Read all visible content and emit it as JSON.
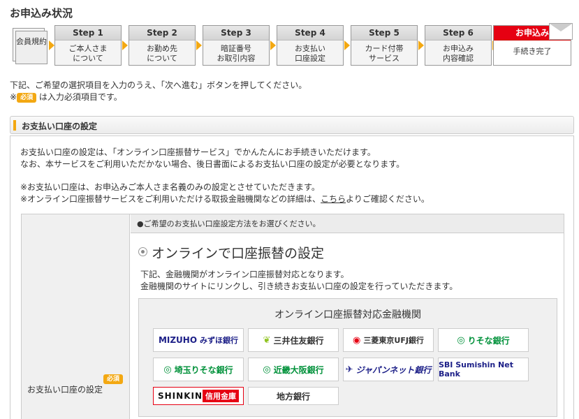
{
  "page": {
    "title": "お申込み状況"
  },
  "steps": {
    "member": "会員規約",
    "items": [
      {
        "head": "Step 1",
        "body1": "ご本人さま",
        "body2": "について"
      },
      {
        "head": "Step 2",
        "body1": "お勤め先",
        "body2": "について"
      },
      {
        "head": "Step 3",
        "body1": "暗証番号",
        "body2": "お取引内容"
      },
      {
        "head": "Step 4",
        "body1": "お支払い",
        "body2": "口座設定"
      },
      {
        "head": "Step 5",
        "body1": "カード付帯",
        "body2": "サービス"
      },
      {
        "head": "Step 6",
        "body1": "お申込み",
        "body2": "内容確認"
      }
    ],
    "final": {
      "head": "お申込み",
      "body": "手続き完了"
    },
    "accent_color": "#e60012",
    "arrow_color": "#f3a812"
  },
  "intro": {
    "line1": "下記、ご希望の選択項目を入力のうえ、「次へ進む」ボタンを押してください。",
    "mark": "※",
    "badge": "必須",
    "line2": "は入力必須項目です。"
  },
  "section": {
    "title": "お支払い口座の設定",
    "desc1": "お支払い口座の設定は、「オンライン口座振替サービス」でかんたんにお手続きいただけます。",
    "desc2": "なお、本サービスをご利用いただかない場合、後日書面によるお支払い口座の設定が必要となります。",
    "note1": "※お支払い口座は、お申込みご本人さま名義のみの設定とさせていただきます。",
    "note2_pre": "※オンライン口座振替サービスをご利用いただける取扱金融機関などの詳細は、",
    "note2_link": "こちら",
    "note2_post": "よりご確認ください。"
  },
  "form": {
    "label": "お支払い口座の設定",
    "required_badge": "必須",
    "select_prompt": "●ご希望のお支払い口座設定方法をお選びください。",
    "option_label": "オンラインで口座振替の設定",
    "option_desc1": "下記、金融機関がオンライン口座振替対応となります。",
    "option_desc2": "金融機関のサイトにリンクし、引き続きお支払い口座の設定を行っていただきます。",
    "banks_title": "オンライン口座振替対応金融機関",
    "banks": {
      "mizuho_logo": "MIZUHO",
      "mizuho": "みずほ銀行",
      "smbc": "三井住友銀行",
      "mufg": "三菱東京UFJ銀行",
      "resona": "りそな銀行",
      "saitama": "埼玉りそな銀行",
      "kinki": "近畿大阪銀行",
      "japannet": "ジャパンネット銀行",
      "sbi": "SBI Sumishin Net Bank",
      "shinkin_1": "SHINKIN",
      "shinkin_2": "信用金庫",
      "chiho": "地方銀行"
    }
  }
}
